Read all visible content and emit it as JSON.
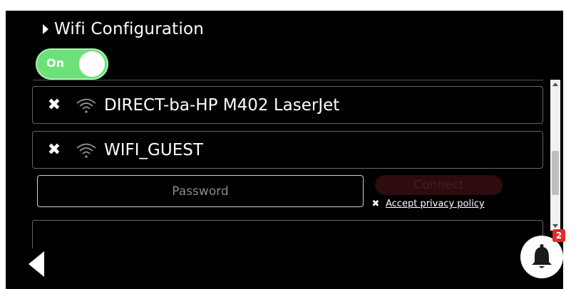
{
  "section": {
    "title": "Wifi Configuration"
  },
  "toggle": {
    "label": "On",
    "state": "on",
    "color": "#6ee07a"
  },
  "networks": [
    {
      "name": "DIRECT-ba-HP M402 LaserJet",
      "remove_icon": "close-icon",
      "signal_icon": "wifi-signal-icon"
    },
    {
      "name": "WIFI_GUEST",
      "remove_icon": "close-icon",
      "signal_icon": "wifi-signal-icon"
    }
  ],
  "password": {
    "value": "",
    "placeholder": "Password"
  },
  "connect": {
    "label": "Connect",
    "color": "#2e0b0f"
  },
  "privacy": {
    "label": "Accept privacy policy"
  },
  "notifications": {
    "count": "2",
    "badge_color": "#e32a2a"
  }
}
